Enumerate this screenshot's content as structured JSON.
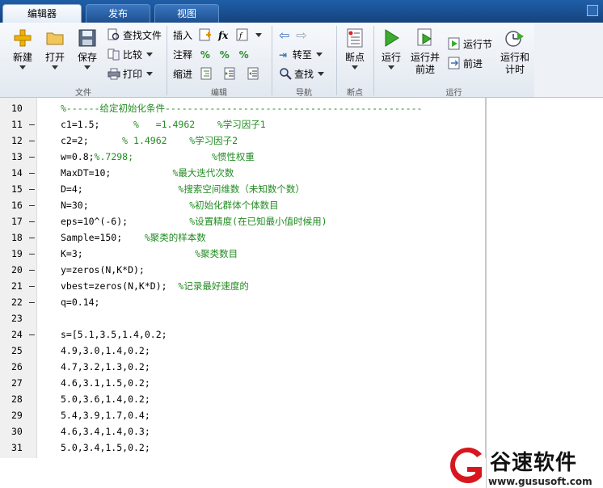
{
  "tabs": [
    {
      "label": "编辑器",
      "active": true
    },
    {
      "label": "发布",
      "active": false
    },
    {
      "label": "视图",
      "active": false
    }
  ],
  "ribbon": {
    "file": {
      "group_label": "文件",
      "new_label": "新建",
      "open_label": "打开",
      "save_label": "保存",
      "find_files_label": "查找文件",
      "compare_label": "比较",
      "print_label": "打印"
    },
    "edit": {
      "group_label": "编辑",
      "insert_label": "插入",
      "comment_label": "注释",
      "indent_label": "缩进",
      "fx_label": "fx"
    },
    "navigate": {
      "group_label": "导航",
      "goto_label": "转至",
      "find_label": "查找"
    },
    "breakpoints": {
      "group_label": "断点",
      "breakpoint_label": "断点"
    },
    "run": {
      "group_label": "运行",
      "run_label": "运行",
      "run_advance_label_1": "运行并",
      "run_advance_label_2": "前进",
      "run_section_label": "运行节",
      "advance_label": "前进",
      "run_time_label_1": "运行和",
      "run_time_label_2": "计时"
    }
  },
  "editor": {
    "lines": [
      {
        "num": "10",
        "bp": "",
        "code": "",
        "comment": "%------给定初始化条件----------------------------------------------"
      },
      {
        "num": "11",
        "bp": "—",
        "code": "c1=1.5;      ",
        "comment": "%   =1.4962    %学习因子1"
      },
      {
        "num": "12",
        "bp": "—",
        "code": "c2=2;      ",
        "comment": "% 1.4962    %学习因子2"
      },
      {
        "num": "13",
        "bp": "—",
        "code": "w=0.8;",
        "comment": "%.7298;              %惯性权重"
      },
      {
        "num": "14",
        "bp": "—",
        "code": "MaxDT=10;           ",
        "comment": "%最大迭代次数"
      },
      {
        "num": "15",
        "bp": "—",
        "code": "D=4;                 ",
        "comment": "%搜索空间维数（未知数个数）"
      },
      {
        "num": "16",
        "bp": "—",
        "code": "N=30;                  ",
        "comment": "%初始化群体个体数目"
      },
      {
        "num": "17",
        "bp": "—",
        "code": "eps=10^(-6);           ",
        "comment": "%设置精度(在已知最小值时候用)"
      },
      {
        "num": "18",
        "bp": "—",
        "code": "Sample=150;    ",
        "comment": "%聚类的样本数"
      },
      {
        "num": "19",
        "bp": "—",
        "code": "K=3;                    ",
        "comment": "%聚类数目"
      },
      {
        "num": "20",
        "bp": "—",
        "code": "y=zeros(N,K*D);",
        "comment": ""
      },
      {
        "num": "21",
        "bp": "—",
        "code": "vbest=zeros(N,K*D);  ",
        "comment": "%记录最好速度的"
      },
      {
        "num": "22",
        "bp": "—",
        "code": "q=0.14;",
        "comment": ""
      },
      {
        "num": "23",
        "bp": "",
        "code": "",
        "comment": ""
      },
      {
        "num": "24",
        "bp": "—",
        "code": "s=[5.1,3.5,1.4,0.2;",
        "comment": ""
      },
      {
        "num": "25",
        "bp": "",
        "code": "4.9,3.0,1.4,0.2;",
        "comment": ""
      },
      {
        "num": "26",
        "bp": "",
        "code": "4.7,3.2,1.3,0.2;",
        "comment": ""
      },
      {
        "num": "27",
        "bp": "",
        "code": "4.6,3.1,1.5,0.2;",
        "comment": ""
      },
      {
        "num": "28",
        "bp": "",
        "code": "5.0,3.6,1.4,0.2;",
        "comment": ""
      },
      {
        "num": "29",
        "bp": "",
        "code": "5.4,3.9,1.7,0.4;",
        "comment": ""
      },
      {
        "num": "30",
        "bp": "",
        "code": "4.6,3.4,1.4,0.3;",
        "comment": ""
      },
      {
        "num": "31",
        "bp": "",
        "code": "5.0,3.4,1.5,0.2;",
        "comment": ""
      }
    ]
  },
  "watermark": {
    "brand": "谷速软件",
    "url": "www.gususoft.com"
  },
  "colors": {
    "comment": "#228b22",
    "tabbar": "#1f5fa8"
  }
}
